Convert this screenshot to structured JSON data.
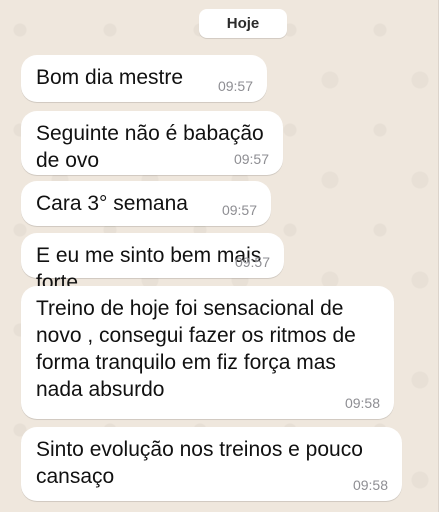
{
  "chat": {
    "day_separator": "Hoje",
    "messages": [
      {
        "text": "Bom dia mestre",
        "time": "09:57"
      },
      {
        "text": "Seguinte não é babação de ovo",
        "time": "09:57"
      },
      {
        "text": "Cara 3° semana",
        "time": "09:57"
      },
      {
        "text": "E eu me sinto bem mais forte",
        "time": "09:57"
      },
      {
        "text": "Treino de hoje foi sensacional de novo , consegui fazer os ritmos de forma tranquilo em fiz força mas nada absurdo",
        "time": "09:58"
      },
      {
        "text": "Sinto evolução nos treinos e pouco cansaço",
        "time": "09:58"
      }
    ]
  },
  "colors": {
    "background": "#efe7dd",
    "bubble": "#ffffff",
    "timestamp": "#8e8e93"
  }
}
